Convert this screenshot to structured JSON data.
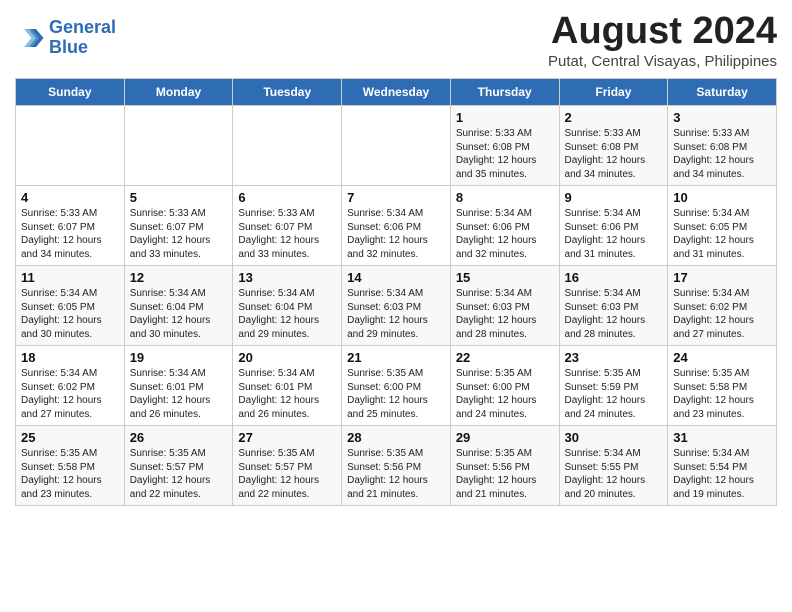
{
  "header": {
    "logo_line1": "General",
    "logo_line2": "Blue",
    "month": "August 2024",
    "location": "Putat, Central Visayas, Philippines"
  },
  "days_of_week": [
    "Sunday",
    "Monday",
    "Tuesday",
    "Wednesday",
    "Thursday",
    "Friday",
    "Saturday"
  ],
  "weeks": [
    [
      {
        "day": "",
        "info": ""
      },
      {
        "day": "",
        "info": ""
      },
      {
        "day": "",
        "info": ""
      },
      {
        "day": "",
        "info": ""
      },
      {
        "day": "1",
        "info": "Sunrise: 5:33 AM\nSunset: 6:08 PM\nDaylight: 12 hours\nand 35 minutes."
      },
      {
        "day": "2",
        "info": "Sunrise: 5:33 AM\nSunset: 6:08 PM\nDaylight: 12 hours\nand 34 minutes."
      },
      {
        "day": "3",
        "info": "Sunrise: 5:33 AM\nSunset: 6:08 PM\nDaylight: 12 hours\nand 34 minutes."
      }
    ],
    [
      {
        "day": "4",
        "info": "Sunrise: 5:33 AM\nSunset: 6:07 PM\nDaylight: 12 hours\nand 34 minutes."
      },
      {
        "day": "5",
        "info": "Sunrise: 5:33 AM\nSunset: 6:07 PM\nDaylight: 12 hours\nand 33 minutes."
      },
      {
        "day": "6",
        "info": "Sunrise: 5:33 AM\nSunset: 6:07 PM\nDaylight: 12 hours\nand 33 minutes."
      },
      {
        "day": "7",
        "info": "Sunrise: 5:34 AM\nSunset: 6:06 PM\nDaylight: 12 hours\nand 32 minutes."
      },
      {
        "day": "8",
        "info": "Sunrise: 5:34 AM\nSunset: 6:06 PM\nDaylight: 12 hours\nand 32 minutes."
      },
      {
        "day": "9",
        "info": "Sunrise: 5:34 AM\nSunset: 6:06 PM\nDaylight: 12 hours\nand 31 minutes."
      },
      {
        "day": "10",
        "info": "Sunrise: 5:34 AM\nSunset: 6:05 PM\nDaylight: 12 hours\nand 31 minutes."
      }
    ],
    [
      {
        "day": "11",
        "info": "Sunrise: 5:34 AM\nSunset: 6:05 PM\nDaylight: 12 hours\nand 30 minutes."
      },
      {
        "day": "12",
        "info": "Sunrise: 5:34 AM\nSunset: 6:04 PM\nDaylight: 12 hours\nand 30 minutes."
      },
      {
        "day": "13",
        "info": "Sunrise: 5:34 AM\nSunset: 6:04 PM\nDaylight: 12 hours\nand 29 minutes."
      },
      {
        "day": "14",
        "info": "Sunrise: 5:34 AM\nSunset: 6:03 PM\nDaylight: 12 hours\nand 29 minutes."
      },
      {
        "day": "15",
        "info": "Sunrise: 5:34 AM\nSunset: 6:03 PM\nDaylight: 12 hours\nand 28 minutes."
      },
      {
        "day": "16",
        "info": "Sunrise: 5:34 AM\nSunset: 6:03 PM\nDaylight: 12 hours\nand 28 minutes."
      },
      {
        "day": "17",
        "info": "Sunrise: 5:34 AM\nSunset: 6:02 PM\nDaylight: 12 hours\nand 27 minutes."
      }
    ],
    [
      {
        "day": "18",
        "info": "Sunrise: 5:34 AM\nSunset: 6:02 PM\nDaylight: 12 hours\nand 27 minutes."
      },
      {
        "day": "19",
        "info": "Sunrise: 5:34 AM\nSunset: 6:01 PM\nDaylight: 12 hours\nand 26 minutes."
      },
      {
        "day": "20",
        "info": "Sunrise: 5:34 AM\nSunset: 6:01 PM\nDaylight: 12 hours\nand 26 minutes."
      },
      {
        "day": "21",
        "info": "Sunrise: 5:35 AM\nSunset: 6:00 PM\nDaylight: 12 hours\nand 25 minutes."
      },
      {
        "day": "22",
        "info": "Sunrise: 5:35 AM\nSunset: 6:00 PM\nDaylight: 12 hours\nand 24 minutes."
      },
      {
        "day": "23",
        "info": "Sunrise: 5:35 AM\nSunset: 5:59 PM\nDaylight: 12 hours\nand 24 minutes."
      },
      {
        "day": "24",
        "info": "Sunrise: 5:35 AM\nSunset: 5:58 PM\nDaylight: 12 hours\nand 23 minutes."
      }
    ],
    [
      {
        "day": "25",
        "info": "Sunrise: 5:35 AM\nSunset: 5:58 PM\nDaylight: 12 hours\nand 23 minutes."
      },
      {
        "day": "26",
        "info": "Sunrise: 5:35 AM\nSunset: 5:57 PM\nDaylight: 12 hours\nand 22 minutes."
      },
      {
        "day": "27",
        "info": "Sunrise: 5:35 AM\nSunset: 5:57 PM\nDaylight: 12 hours\nand 22 minutes."
      },
      {
        "day": "28",
        "info": "Sunrise: 5:35 AM\nSunset: 5:56 PM\nDaylight: 12 hours\nand 21 minutes."
      },
      {
        "day": "29",
        "info": "Sunrise: 5:35 AM\nSunset: 5:56 PM\nDaylight: 12 hours\nand 21 minutes."
      },
      {
        "day": "30",
        "info": "Sunrise: 5:34 AM\nSunset: 5:55 PM\nDaylight: 12 hours\nand 20 minutes."
      },
      {
        "day": "31",
        "info": "Sunrise: 5:34 AM\nSunset: 5:54 PM\nDaylight: 12 hours\nand 19 minutes."
      }
    ]
  ]
}
